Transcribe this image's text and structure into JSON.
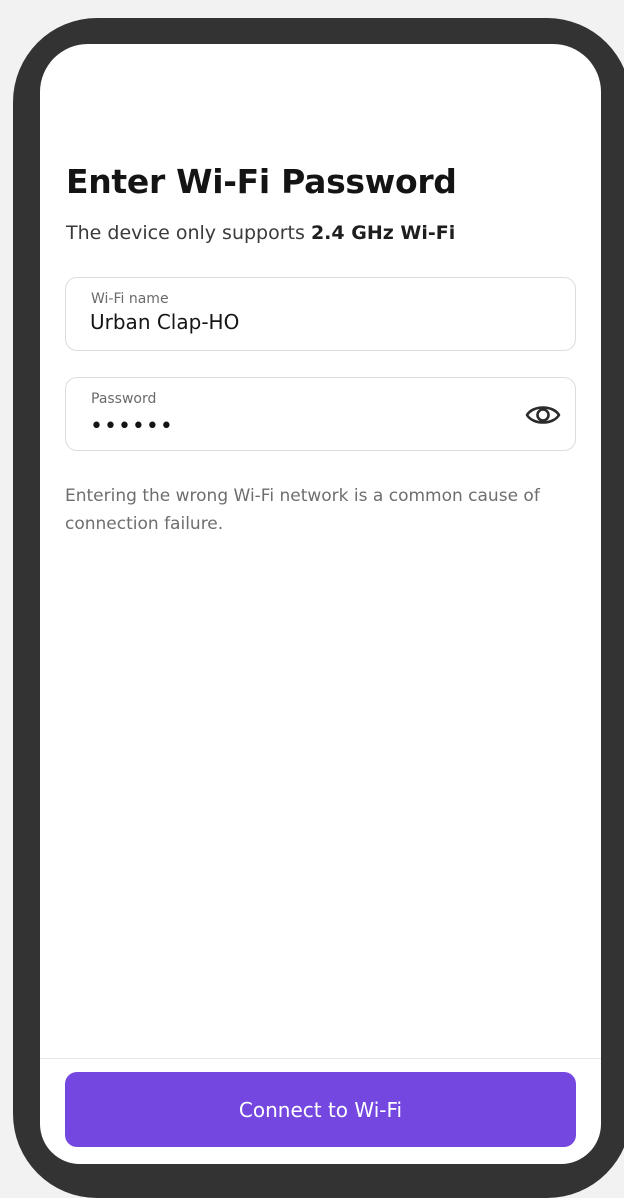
{
  "header": {
    "title": "Enter Wi-Fi Password",
    "subtitle_prefix": "The device only supports ",
    "subtitle_emphasis": "2.4 GHz Wi-Fi"
  },
  "form": {
    "wifi_name": {
      "label": "Wi-Fi name",
      "value": "Urban Clap-HO"
    },
    "password": {
      "label": "Password",
      "masked_value": "••••••",
      "toggle_icon": "eye-icon"
    }
  },
  "hint": "Entering the wrong Wi-Fi network is a common cause of connection failure.",
  "actions": {
    "connect_label": "Connect to Wi-Fi"
  },
  "colors": {
    "accent": "#7448E0",
    "frame": "#333333",
    "background": "#F2F2F2"
  }
}
